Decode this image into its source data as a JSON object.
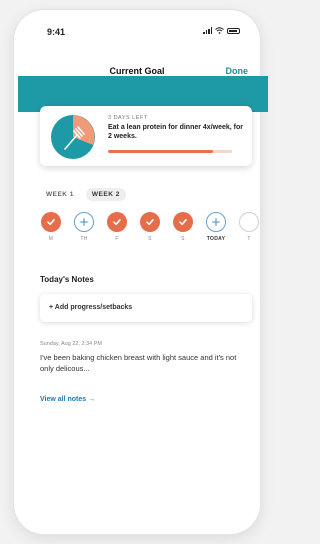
{
  "status_bar": {
    "time": "9:41"
  },
  "nav": {
    "title": "Current Goal",
    "done_label": "Done"
  },
  "goal": {
    "days_left": "3 DAYS LEFT",
    "text": "Eat a lean protein for dinner 4x/week, for 2 weeks.",
    "progress": 0.85
  },
  "weeks": [
    {
      "label": "WEEK 1",
      "active": false
    },
    {
      "label": "WEEK 2",
      "active": true
    }
  ],
  "days": [
    {
      "label": "M",
      "state": "done"
    },
    {
      "label": "TH",
      "state": "add"
    },
    {
      "label": "F",
      "state": "done"
    },
    {
      "label": "S",
      "state": "done"
    },
    {
      "label": "S",
      "state": "done"
    },
    {
      "label": "TODAY",
      "state": "add"
    },
    {
      "label": "T",
      "state": "empty"
    }
  ],
  "notes": {
    "title": "Today's Notes",
    "add_label": "+ Add progress/setbacks",
    "latest_date": "Sunday, Aug 22, 2:34 PM",
    "latest_text": "I've been baking chicken breast with light sauce and it's not only delicous...",
    "view_all_label": "View all notes →"
  },
  "colors": {
    "accent_teal": "#1e9aa6",
    "progress_orange": "#e8714d",
    "check_orange": "#e56d4a",
    "add_blue": "#6b9dc6",
    "link_blue": "#1d79b8"
  }
}
